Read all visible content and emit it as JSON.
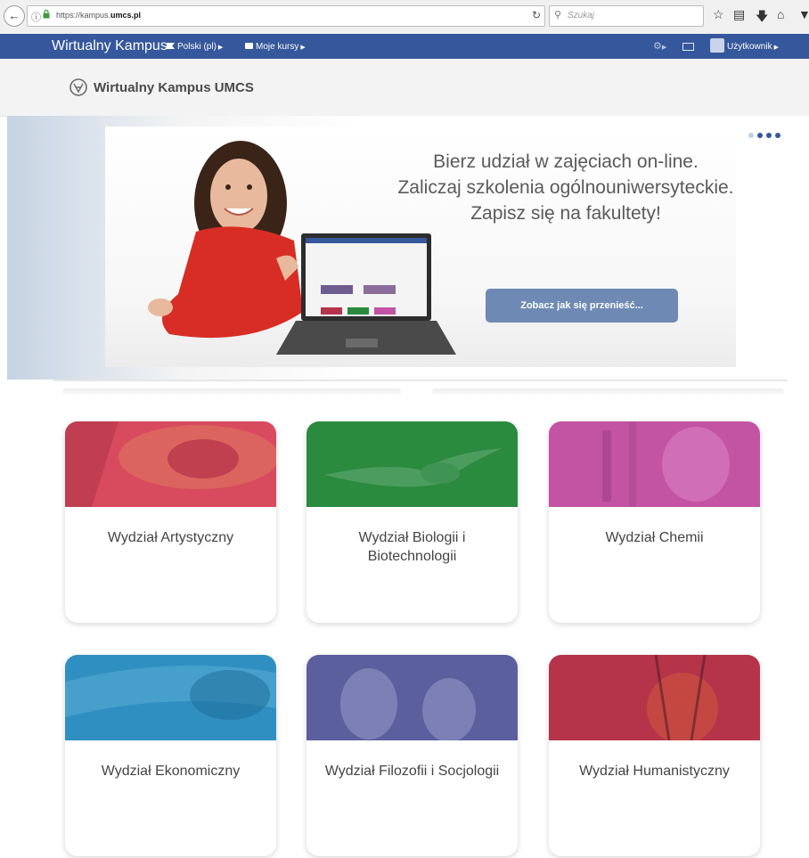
{
  "browser": {
    "url_prefix": "https://kampus.",
    "url_domain": "umcs.pl",
    "search_placeholder": "Szukaj"
  },
  "navbar": {
    "brand": "Wirtualny Kampus",
    "language": "Polski (pl)",
    "my_courses": "Moje kursy",
    "user": "Użytkownik",
    "bg_color": "#35579b"
  },
  "header": {
    "site_name": "Wirtualny Kampus UMCS"
  },
  "hero": {
    "line1": "Bierz udział w zajęciach on-line.",
    "line2": "Zaliczaj szkolenia ogólnouniwersyteckie.",
    "line3": "Zapisz się na fakultety!",
    "button": "Zobacz jak się przenieść...",
    "button_color": "#6e8ab4",
    "slides_total": 4,
    "active_slide": 1
  },
  "faculties": [
    {
      "title": "Wydział Artystyczny",
      "color": "#d84a5e"
    },
    {
      "title": "Wydział Biologii i Biotechnologii",
      "color": "#2a8a3e"
    },
    {
      "title": "Wydział Chemii",
      "color": "#c353a3"
    },
    {
      "title": "Wydział Ekonomiczny",
      "color": "#2f8fc0"
    },
    {
      "title": "Wydział Filozofii i Socjologii",
      "color": "#5b5f9e"
    },
    {
      "title": "Wydział Humanistyczny",
      "color": "#b5344a"
    }
  ]
}
